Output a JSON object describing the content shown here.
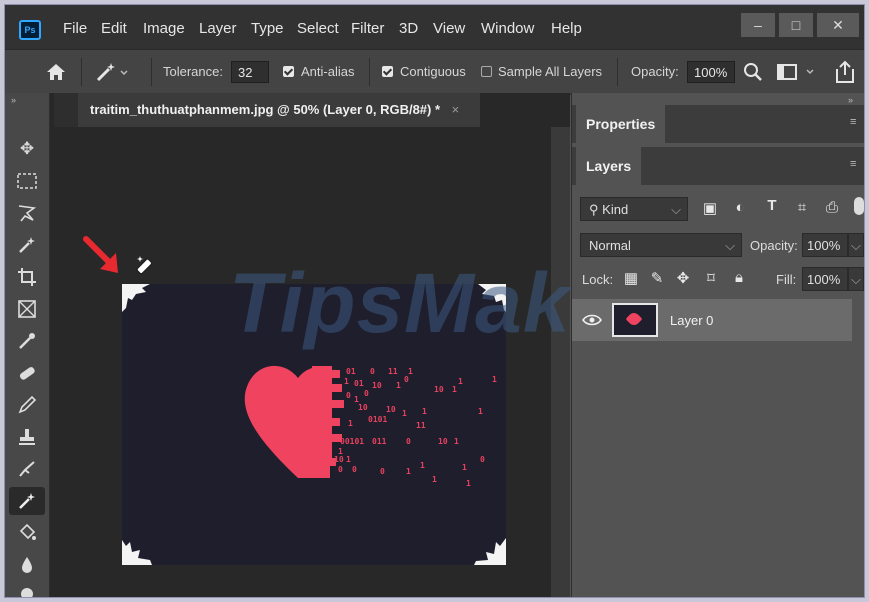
{
  "menubar": {
    "logo": "Ps",
    "items": [
      "File",
      "Edit",
      "Image",
      "Layer",
      "Type",
      "Select",
      "Filter",
      "3D",
      "View",
      "Window",
      "Help"
    ],
    "window_buttons": [
      "–",
      "□",
      "✕"
    ]
  },
  "options": {
    "tolerance_label": "Tolerance:",
    "tolerance_value": "32",
    "antialias_label": "Anti-alias",
    "antialias_checked": true,
    "contiguous_label": "Contiguous",
    "contiguous_checked": true,
    "sample_all_label": "Sample All Layers",
    "sample_all_checked": false,
    "opacity_label": "Opacity:",
    "opacity_value": "100%"
  },
  "document": {
    "tab_title": "traitim_thuthuatphanmem.jpg @ 50% (Layer 0, RGB/8#) *",
    "close": "×"
  },
  "watermark": "TipsMake",
  "panels": {
    "properties_tab": "Properties",
    "layers_tab": "Layers",
    "filter_kind": "Kind",
    "blend_mode": "Normal",
    "opacity_label": "Opacity:",
    "opacity_value": "100%",
    "lock_label": "Lock:",
    "fill_label": "Fill:",
    "fill_value": "100%",
    "layers": [
      {
        "name": "Layer 0",
        "visible": true
      }
    ]
  },
  "canvas": {
    "background_color": "#1e1e2c",
    "heart_color": "#f0435f",
    "binary_text": [
      "01",
      "0",
      "11",
      "1",
      "1",
      "01",
      "10",
      "1",
      "0",
      "1",
      "1",
      "10",
      "1",
      "0",
      "1",
      "0",
      "10",
      "10",
      "1",
      "1",
      "1",
      "0101",
      "11",
      "1",
      "00101",
      "011",
      "0",
      "10",
      "1",
      "1",
      "10",
      "1",
      "0",
      "0",
      "0",
      "1",
      "1",
      "1",
      "1",
      "0",
      "1"
    ]
  },
  "colors": {
    "accent_blue": "#31a8ff",
    "arrow_red": "#e8292f"
  }
}
